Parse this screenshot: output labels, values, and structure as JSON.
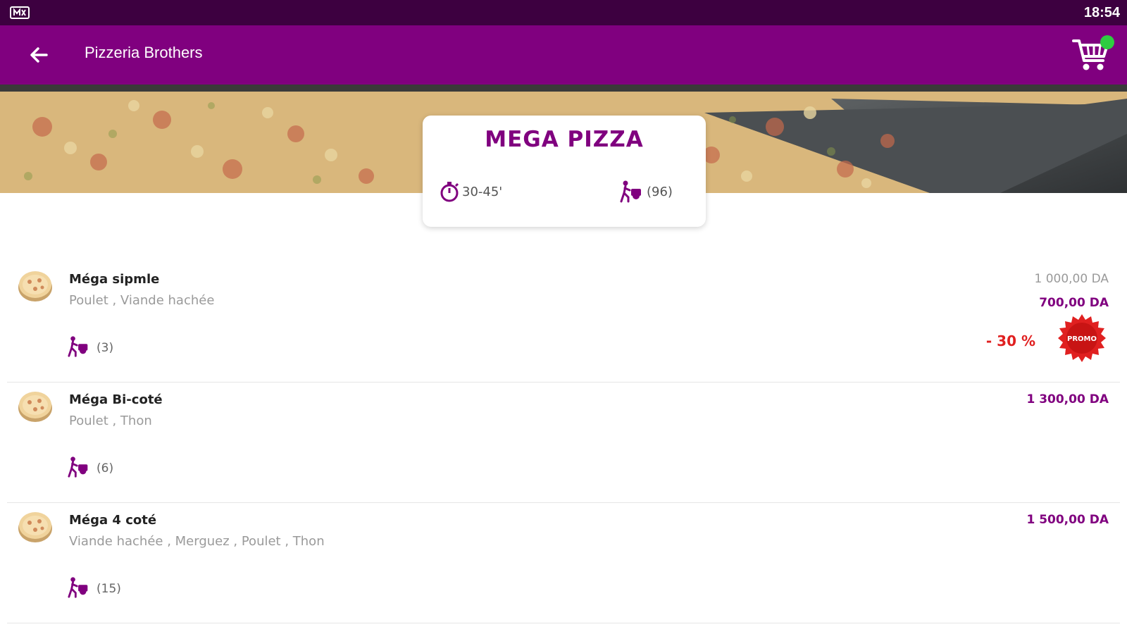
{
  "status_bar": {
    "time": "18:54",
    "left_icon": "notification-icon"
  },
  "app_bar": {
    "title": "Pizzeria Brothers",
    "back_icon": "arrow-back-icon",
    "cart_icon": "shopping-cart-icon"
  },
  "category_card": {
    "title": "MEGA PIZZA",
    "time": "30-45'",
    "delivery_count": "(96)"
  },
  "items": [
    {
      "name": "Méga sipmle",
      "ingredients": "Poulet , Viande hachée",
      "delivery_count": "(3)",
      "price_old": "1 000,00 DA",
      "price": "700,00 DA",
      "discount": "- 30 %",
      "promo_label": "PROMO"
    },
    {
      "name": "Méga Bi-coté",
      "ingredients": "Poulet , Thon",
      "delivery_count": "(6)",
      "price": "1 300,00 DA"
    },
    {
      "name": "Méga 4 coté",
      "ingredients": "Viande hachée , Merguez , Poulet , Thon",
      "delivery_count": "(15)",
      "price": "1 500,00 DA"
    }
  ],
  "colors": {
    "primary": "#80007f",
    "status_bar": "#3d0040",
    "promo": "#e02020",
    "badge": "#2ecc40"
  }
}
